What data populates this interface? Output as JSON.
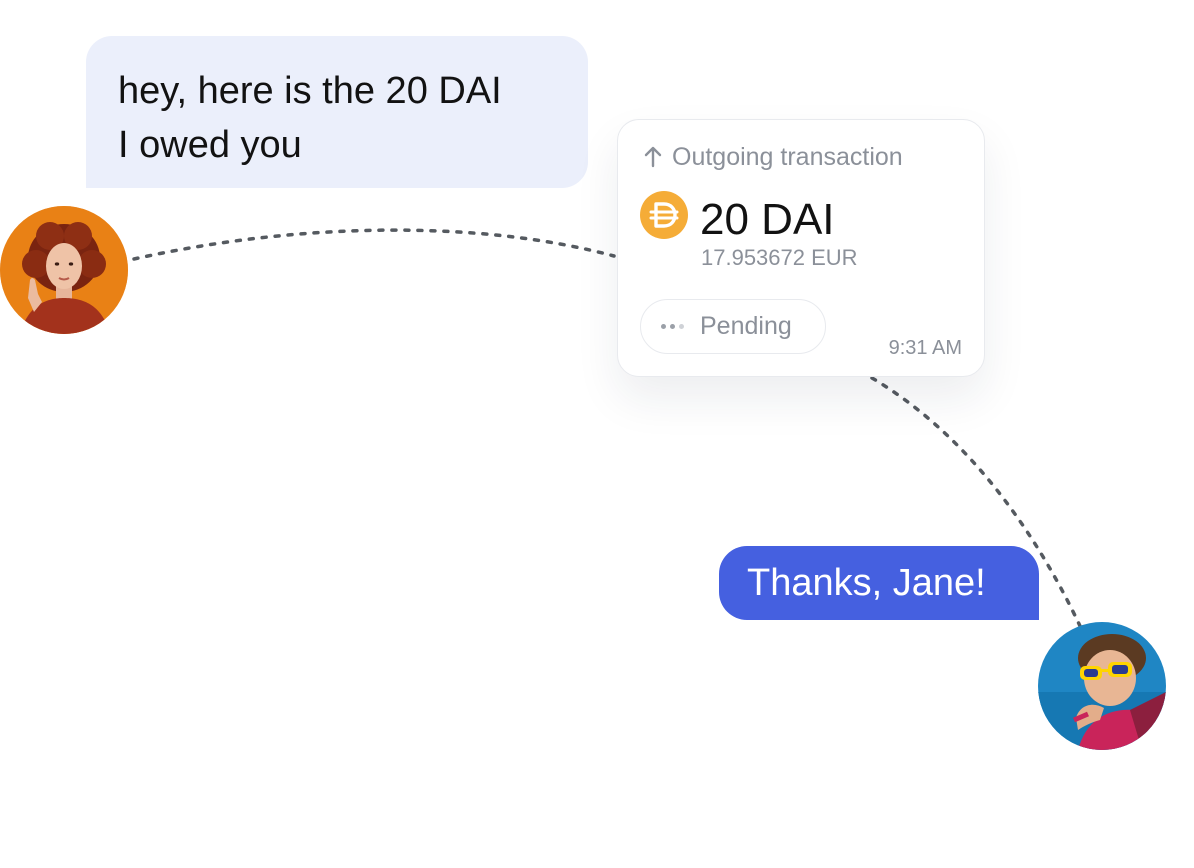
{
  "incoming_message": {
    "line1": "hey, here is the 20 DAI",
    "line2": "I owed you",
    "sender_avatar": "jane-avatar"
  },
  "transaction": {
    "direction_icon": "arrow-up-icon",
    "header": "Outgoing transaction",
    "token_icon": "dai-icon",
    "amount": "20 DAI",
    "fiat_value": "17.953672 EUR",
    "status": "Pending",
    "time": "9:31 AM"
  },
  "outgoing_message": {
    "text": "Thanks, Jane!",
    "sender_avatar": "friend-avatar"
  },
  "colors": {
    "incoming_bubble": "#ebeffb",
    "outgoing_bubble": "#4560e0",
    "dai_token": "#f5ac37",
    "muted_text": "#8b9099"
  }
}
